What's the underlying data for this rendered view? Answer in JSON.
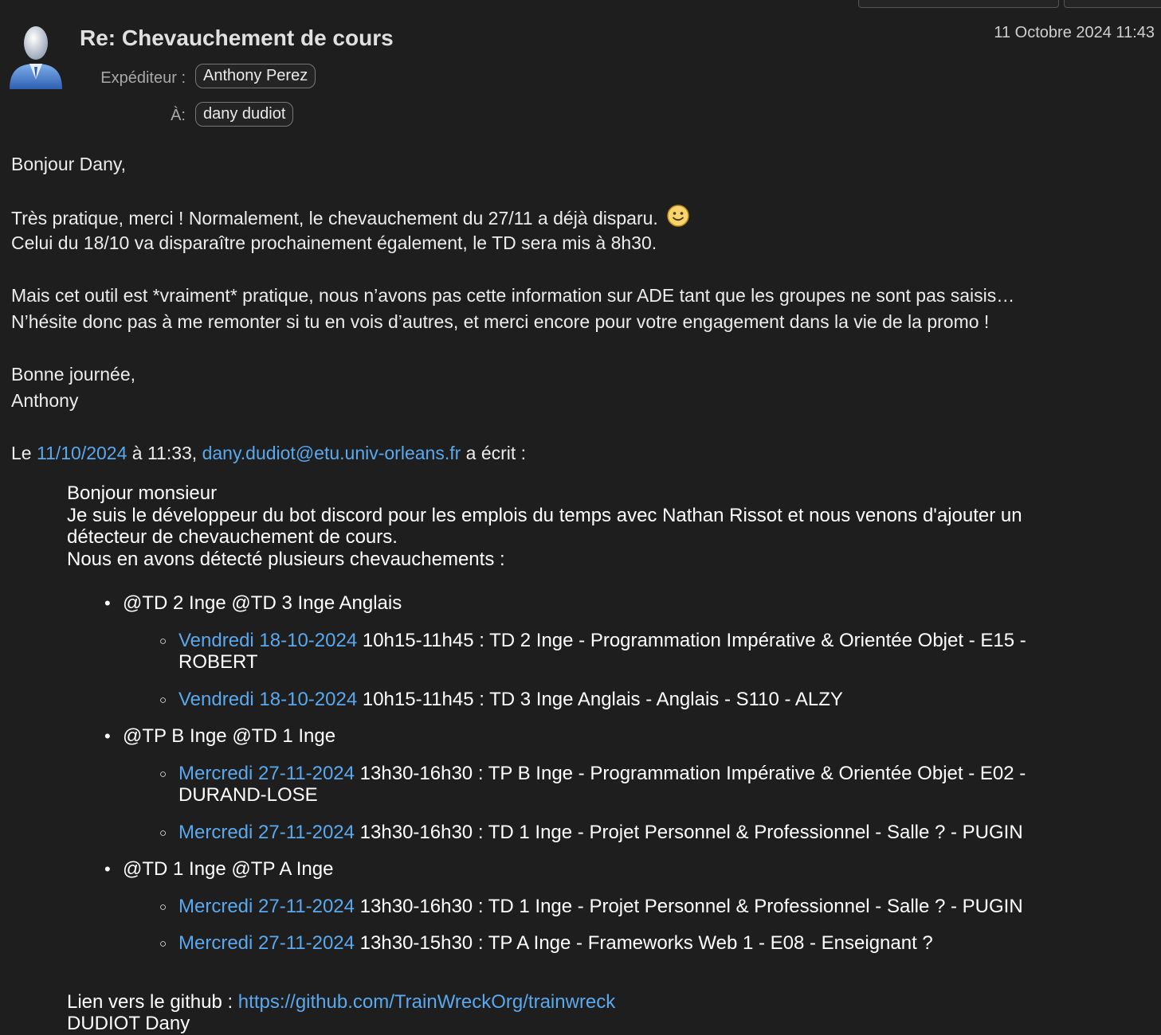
{
  "email": {
    "subject": "Re: Chevauchement de cours",
    "date": "11 Octobre 2024 11:43",
    "sender_label": "Expéditeur :",
    "sender": "Anthony Perez",
    "to_label": "À:",
    "to": "dany dudiot"
  },
  "body": {
    "greeting": "Bonjour Dany,",
    "p1_line1": "Très pratique, merci ! Normalement, le chevauchement du 27/11 a déjà disparu.",
    "p1_line2": "Celui du 18/10 va disparaître prochainement également, le TD sera mis à 8h30.",
    "p2_line1": "Mais cet outil est *vraiment* pratique, nous n’avons pas cette information sur ADE tant que les groupes ne sont pas saisis…",
    "p2_line2": "N’hésite donc pas à me remonter si tu en vois d’autres, et merci encore pour votre engagement dans la vie de la promo !",
    "closing": "Bonne journée,",
    "signature": "Anthony",
    "quote_intro_prefix": "Le ",
    "quote_intro_date": "11/10/2024",
    "quote_intro_mid": " à 11:33, ",
    "quote_intro_email": "dany.dudiot@etu.univ-orleans.fr",
    "quote_intro_suffix": " a écrit :"
  },
  "quote": {
    "line1": "Bonjour monsieur",
    "line2": "Je suis le développeur du bot discord pour les emplois du temps avec Nathan Rissot et nous venons d'ajouter un",
    "line3": "détecteur de chevauchement de cours.",
    "line4": "Nous en avons détecté plusieurs chevauchements :",
    "groups": [
      {
        "title": "@TD 2 Inge @TD 3 Inge Anglais",
        "items": [
          {
            "date": "Vendredi 18-10-2024",
            "text": " 10h15-11h45 : TD 2 Inge - Programmation Impérative & Orientée Objet - E15 -",
            "text2": "ROBERT"
          },
          {
            "date": "Vendredi 18-10-2024",
            "text": " 10h15-11h45 : TD 3 Inge Anglais - Anglais - S110 - ALZY",
            "text2": ""
          }
        ]
      },
      {
        "title": "@TP B Inge @TD 1 Inge",
        "items": [
          {
            "date": "Mercredi 27-11-2024",
            "text": " 13h30-16h30 : TP B Inge - Programmation Impérative & Orientée Objet - E02 -",
            "text2": "DURAND-LOSE"
          },
          {
            "date": "Mercredi 27-11-2024",
            "text": " 13h30-16h30 : TD 1 Inge - Projet Personnel & Professionnel - Salle ? - PUGIN",
            "text2": ""
          }
        ]
      },
      {
        "title": "@TD 1 Inge @TP A Inge",
        "items": [
          {
            "date": "Mercredi 27-11-2024",
            "text": " 13h30-16h30 : TD 1 Inge - Projet Personnel & Professionnel - Salle ? - PUGIN",
            "text2": ""
          },
          {
            "date": "Mercredi 27-11-2024",
            "text": " 13h30-15h30 : TP A Inge - Frameworks Web 1 - E08 - Enseignant ?",
            "text2": ""
          }
        ]
      }
    ],
    "github_label": "Lien vers le github : ",
    "github_url": "https://github.com/TrainWreckOrg/trainwreck",
    "sign": "DUDIOT Dany"
  },
  "icons": {
    "avatar": "user-avatar-icon",
    "smiley": "smiley-emoji-icon"
  }
}
